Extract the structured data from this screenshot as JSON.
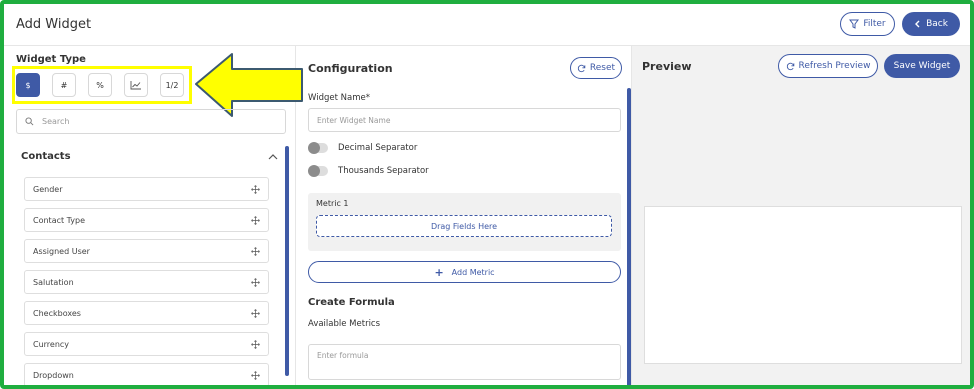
{
  "app": {
    "title": "Add Widget"
  },
  "header": {
    "filter_label": "Filter",
    "back_label": "Back"
  },
  "left": {
    "widget_type_label": "Widget Type",
    "types": [
      "$",
      "#",
      "%",
      "",
      "1/2"
    ],
    "active_type_index": 0,
    "search": {
      "placeholder": "Search"
    },
    "section_title": "Contacts",
    "fields": [
      "Gender",
      "Contact Type",
      "Assigned User",
      "Salutation",
      "Checkboxes",
      "Currency",
      "Dropdown"
    ]
  },
  "config": {
    "title": "Configuration",
    "reset_label": "Reset",
    "widget_name_label": "Widget Name*",
    "widget_name_placeholder": "Enter Widget Name",
    "decimal_label": "Decimal Separator",
    "thousands_label": "Thousands Separator",
    "metric_label": "Metric 1",
    "dropzone_label": "Drag Fields Here",
    "add_metric_label": "Add Metric",
    "formula_title": "Create Formula",
    "available_metrics_label": "Available Metrics",
    "formula_placeholder": "Enter formula"
  },
  "preview": {
    "title": "Preview",
    "refresh_label": "Refresh Preview",
    "save_label": "Save Widget"
  },
  "colors": {
    "accent": "#3f5aa6",
    "frame": "#1fae3f",
    "highlight": "#ffff00"
  }
}
